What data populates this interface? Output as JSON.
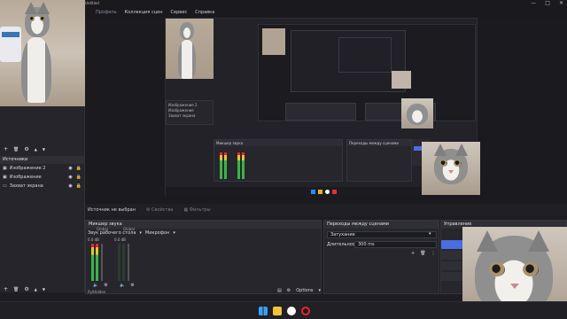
{
  "window": {
    "title": "Untitled"
  },
  "menu": [
    {
      "label": "Профиль"
    },
    {
      "label": "Коллекция сцен"
    },
    {
      "label": "Сервис"
    },
    {
      "label": "Справка"
    }
  ],
  "window_controls": {
    "minimize": "—",
    "maximize": "□",
    "close": "✕"
  },
  "sources": {
    "header": "Источники",
    "items": [
      {
        "label": "Изображение 2"
      },
      {
        "label": "Изображение"
      },
      {
        "label": "Захват экрана"
      }
    ],
    "toolbar": [
      "+",
      "🗑",
      "⚙",
      "▲",
      "▼"
    ]
  },
  "scene_toolbar": [
    "+",
    "🗑",
    "⚙",
    "▲",
    "▼"
  ],
  "source_bar": {
    "no_source": "Источник не выбран",
    "properties": "Свойства",
    "filters": "Фильтры"
  },
  "mixer": {
    "header": "Микшер звука",
    "channels": [
      {
        "label": "Звук рабочего стола"
      },
      {
        "label": "Микрофон"
      }
    ],
    "global": "Global",
    "db": [
      "0.0 dB",
      "0.0 dB"
    ],
    "footer": "Ру/Hidden",
    "options": "Options"
  },
  "transitions": {
    "header": "Переходы между сценами",
    "selected": "Затухание",
    "duration_label": "Длительность",
    "duration_value": "300 ms"
  },
  "controls": {
    "header": "Управление"
  },
  "inner": {
    "cat_panel_label": "Изображение",
    "items": [
      "Изображение 2",
      "Изображение",
      "Захват экрана"
    ],
    "mixer": "Микшер звука",
    "transitions": "Переходы между сценами"
  },
  "colors": {
    "accent": "#4a6de0",
    "panel": "#26262c",
    "bg": "#1e1e22"
  }
}
